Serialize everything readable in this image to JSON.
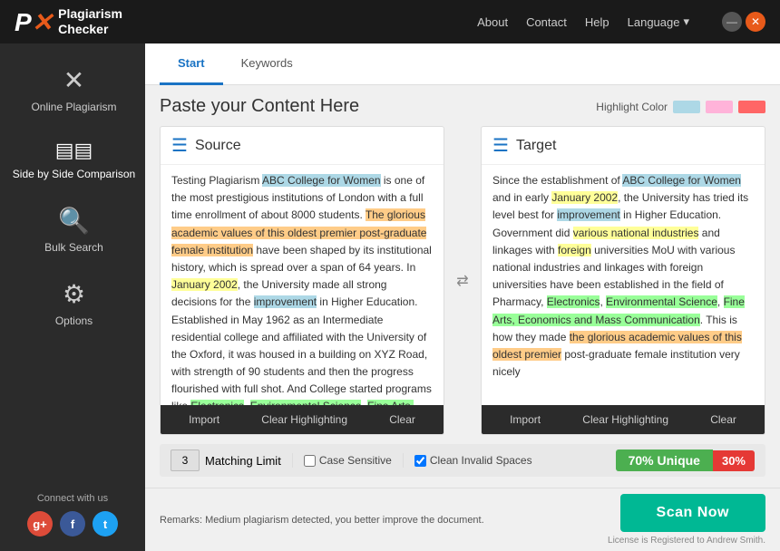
{
  "header": {
    "logo_name": "Plagiarism",
    "logo_sub": "Checker",
    "nav": {
      "about": "About",
      "contact": "Contact",
      "help": "Help",
      "language": "Language"
    },
    "win_minimize": "—",
    "win_close": "✕"
  },
  "sidebar": {
    "items": [
      {
        "id": "online-plagiarism",
        "label": "Online Plagiarism",
        "icon": "✕"
      },
      {
        "id": "side-by-side",
        "label": "Side by Side Comparison",
        "icon": "❏"
      },
      {
        "id": "bulk-search",
        "label": "Bulk Search",
        "icon": "🔍"
      },
      {
        "id": "options",
        "label": "Options",
        "icon": "⚙"
      }
    ],
    "connect": "Connect with us",
    "socials": [
      "g+",
      "f",
      "t"
    ]
  },
  "tabs": [
    {
      "id": "start",
      "label": "Start"
    },
    {
      "id": "keywords",
      "label": "Keywords"
    }
  ],
  "main": {
    "title": "Paste your Content Here",
    "highlight_label": "Highlight Color",
    "source_panel": {
      "title": "Source",
      "footer_import": "Import",
      "footer_clear_highlighting": "Clear Highlighting",
      "footer_clear": "Clear"
    },
    "target_panel": {
      "title": "Target",
      "footer_import": "Import",
      "footer_clear_highlighting": "Clear Highlighting",
      "footer_clear": "Clear"
    },
    "options": {
      "matching_limit_label": "Matching Limit",
      "matching_limit_value": "3",
      "case_sensitive_label": "Case Sensitive",
      "clean_spaces_label": "Clean Invalid Spaces",
      "unique_label": "70% Unique",
      "plagiarism_pct": "30%"
    },
    "remarks": "Remarks: Medium plagiarism detected, you better improve the document.",
    "scan_btn": "Scan Now",
    "license": "License is Registered to Andrew Smith."
  }
}
